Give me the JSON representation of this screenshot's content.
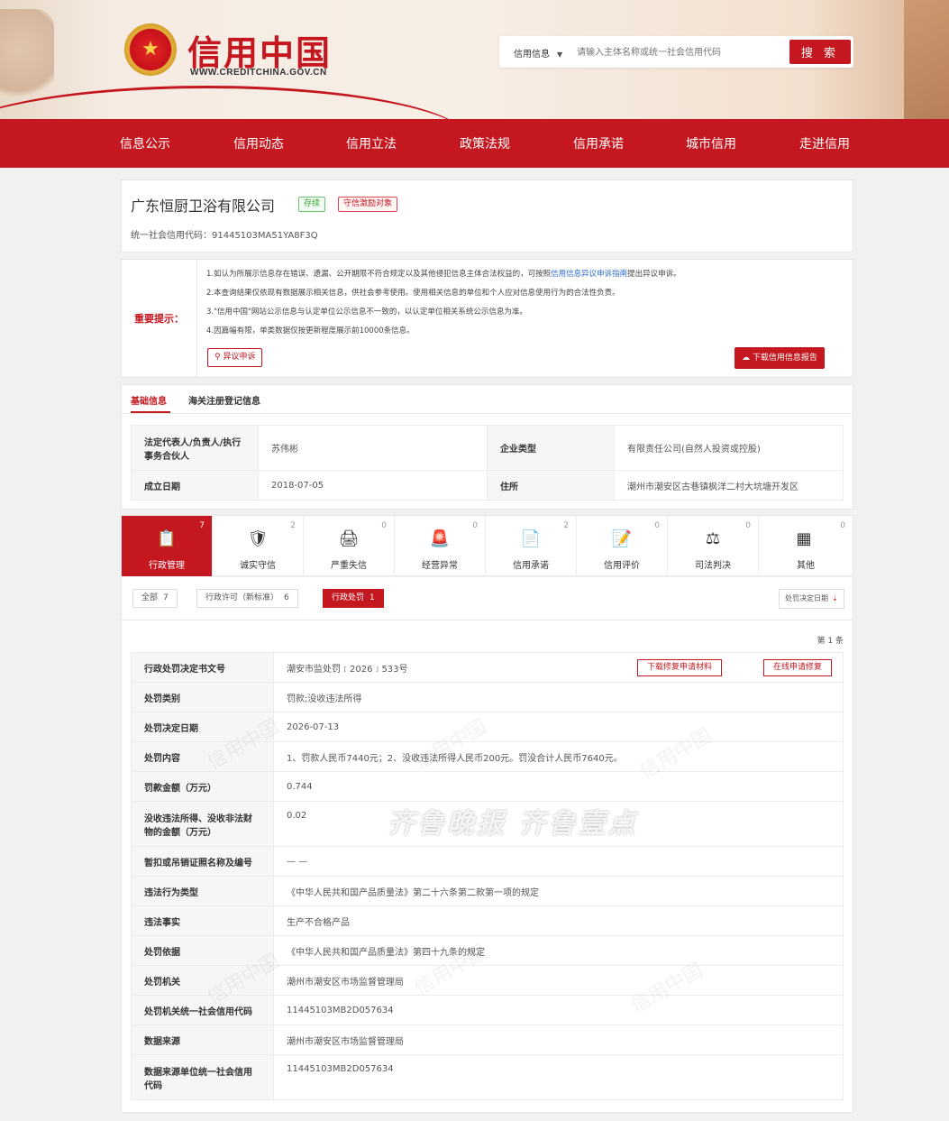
{
  "brand": {
    "emblem_glyph": "★",
    "title": "信用中国",
    "url": "WWW.CREDITCHINA.GOV.CN"
  },
  "search": {
    "type_label": "信用信息",
    "placeholder": "请输入主体名称或统一社会信用代码",
    "button_label": "搜 索"
  },
  "nav": [
    "信息公示",
    "信用动态",
    "信用立法",
    "政策法规",
    "信用承诺",
    "城市信用",
    "走进信用"
  ],
  "company": {
    "name": "广东恒厨卫浴有限公司",
    "status_tag": "存续",
    "honor_tag": "守信激励对象",
    "credit_code_label": "统一社会信用代码：",
    "credit_code": "91445103MA51YA8F3Q"
  },
  "notice": {
    "label": "重要提示：",
    "line1_pre": "1.如认为所展示信息存在错误、遗漏、公开期限不符合规定以及其他侵犯信息主体合法权益的，可按照",
    "line1_link": "信用信息异议申诉指南",
    "line1_post": "提出异议申诉。",
    "line2": "2.本查询结果仅依现有数据展示相关信息，供社会参考使用。使用相关信息的单位和个人应对信息使用行为的合法性负责。",
    "line3": "3.\"信用中国\"网站公示信息与认定单位公示信息不一致的，以认定单位相关系统公示信息为准。",
    "line4": "4.因篇幅有限，单类数据仅按更新程度展示前10000条信息。",
    "objection_button": "异议申诉",
    "download_button": "下载信用信息报告"
  },
  "basic": {
    "tab_active": "基础信息",
    "tab_other": "海关注册登记信息",
    "rows": [
      {
        "k1": "法定代表人/负责人/执行事务合伙人",
        "v1": "苏伟彬",
        "k2": "企业类型",
        "v2": "有限责任公司(自然人投资或控股)"
      },
      {
        "k1": "成立日期",
        "v1": "2018-07-05",
        "k2": "住所",
        "v2": "潮州市潮安区古巷镇枫洋二村大坑塘开发区"
      }
    ]
  },
  "categories": [
    {
      "label": "行政管理",
      "count": "7",
      "icon": "admin-icon",
      "glyph": "📋"
    },
    {
      "label": "诚实守信",
      "count": "2",
      "icon": "shield-icon",
      "glyph": "🛡"
    },
    {
      "label": "严重失信",
      "count": "0",
      "icon": "dishonest-icon",
      "glyph": "🖨"
    },
    {
      "label": "经营异常",
      "count": "0",
      "icon": "alarm-icon",
      "glyph": "🚨"
    },
    {
      "label": "信用承诺",
      "count": "2",
      "icon": "commitment-icon",
      "glyph": "📄"
    },
    {
      "label": "信用评价",
      "count": "0",
      "icon": "evaluation-icon",
      "glyph": "📝"
    },
    {
      "label": "司法判决",
      "count": "0",
      "icon": "judgment-icon",
      "glyph": "⚖"
    },
    {
      "label": "其他",
      "count": "0",
      "icon": "other-icon",
      "glyph": "▦"
    }
  ],
  "filters": [
    {
      "label": "全部",
      "count": "7"
    },
    {
      "label": "行政许可（新标准）",
      "count": "6"
    },
    {
      "label": "行政处罚",
      "count": "1"
    }
  ],
  "sort_label": "处罚决定日期",
  "page_indicator": "第 1 条",
  "record": {
    "repair_download_button": "下载修复申请材料",
    "repair_online_button": "在线申请修复",
    "rows": [
      {
        "k": "行政处罚决定书文号",
        "v": "潮安市监处罚﹝2026﹞533号"
      },
      {
        "k": "处罚类别",
        "v": "罚款;没收违法所得"
      },
      {
        "k": "处罚决定日期",
        "v": "2026-07-13"
      },
      {
        "k": "处罚内容",
        "v": "1、罚款人民币7440元；2、没收违法所得人民币200元。罚没合计人民币7640元。"
      },
      {
        "k": "罚款金额（万元）",
        "v": "0.744"
      },
      {
        "k": "没收违法所得、没收非法财物的金额（万元）",
        "v": "0.02"
      },
      {
        "k": "暂扣或吊销证照名称及编号",
        "v": "— —"
      },
      {
        "k": "违法行为类型",
        "v": "《中华人民共和国产品质量法》第二十六条第二款第一项的规定"
      },
      {
        "k": "违法事实",
        "v": "生产不合格产品"
      },
      {
        "k": "处罚依据",
        "v": "《中华人民共和国产品质量法》第四十九条的规定"
      },
      {
        "k": "处罚机关",
        "v": "潮州市潮安区市场监督管理局"
      },
      {
        "k": "处罚机关统一社会信用代码",
        "v": "11445103MB2D057634"
      },
      {
        "k": "数据来源",
        "v": "潮州市潮安区市场监督管理局"
      },
      {
        "k": "数据来源单位统一社会信用代码",
        "v": "11445103MB2D057634"
      }
    ]
  },
  "watermark": {
    "main": "齐鲁晚报 齐鲁壹点",
    "repeat": "信用中国"
  },
  "colors": {
    "brand_red": "#c4171f",
    "link_blue": "#2a6acb",
    "status_green": "#3aa339"
  }
}
